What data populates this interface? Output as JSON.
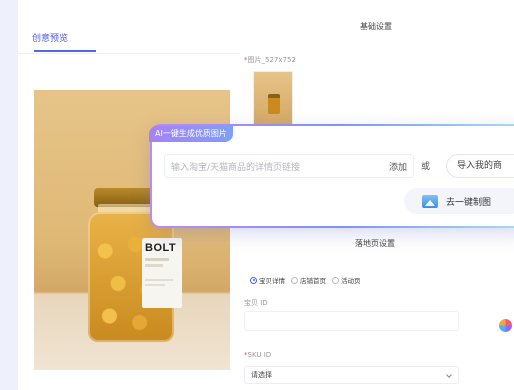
{
  "left_panel": {
    "tab_label": "创意预览"
  },
  "product": {
    "brand": "BOLT"
  },
  "right_panel": {
    "basic_settings_title": "基础设置",
    "image_field_label": "图片_527x752",
    "landing_title": "落地页设置",
    "radio_options": [
      {
        "label": "宝贝详情",
        "selected": true
      },
      {
        "label": "店铺首页",
        "selected": false
      },
      {
        "label": "活动页",
        "selected": false
      }
    ],
    "item_id_label": "宝贝 ID",
    "sku_label": "SKU ID",
    "sku_select_value": "请选择"
  },
  "ai_popup": {
    "badge": "AI一键生成优质图片",
    "input_placeholder": "输入淘宝/天猫商品的详情页链接",
    "add_label": "添加",
    "or_label": "或",
    "import_label": "导入我的商",
    "generate_label": "去一键制图",
    "accent_start": "#a881f5",
    "accent_end": "#7ea0f7"
  },
  "icons": {
    "generate": "image-icon",
    "float": "color-wheel-icon",
    "dropdown": "chevron-down-icon"
  }
}
